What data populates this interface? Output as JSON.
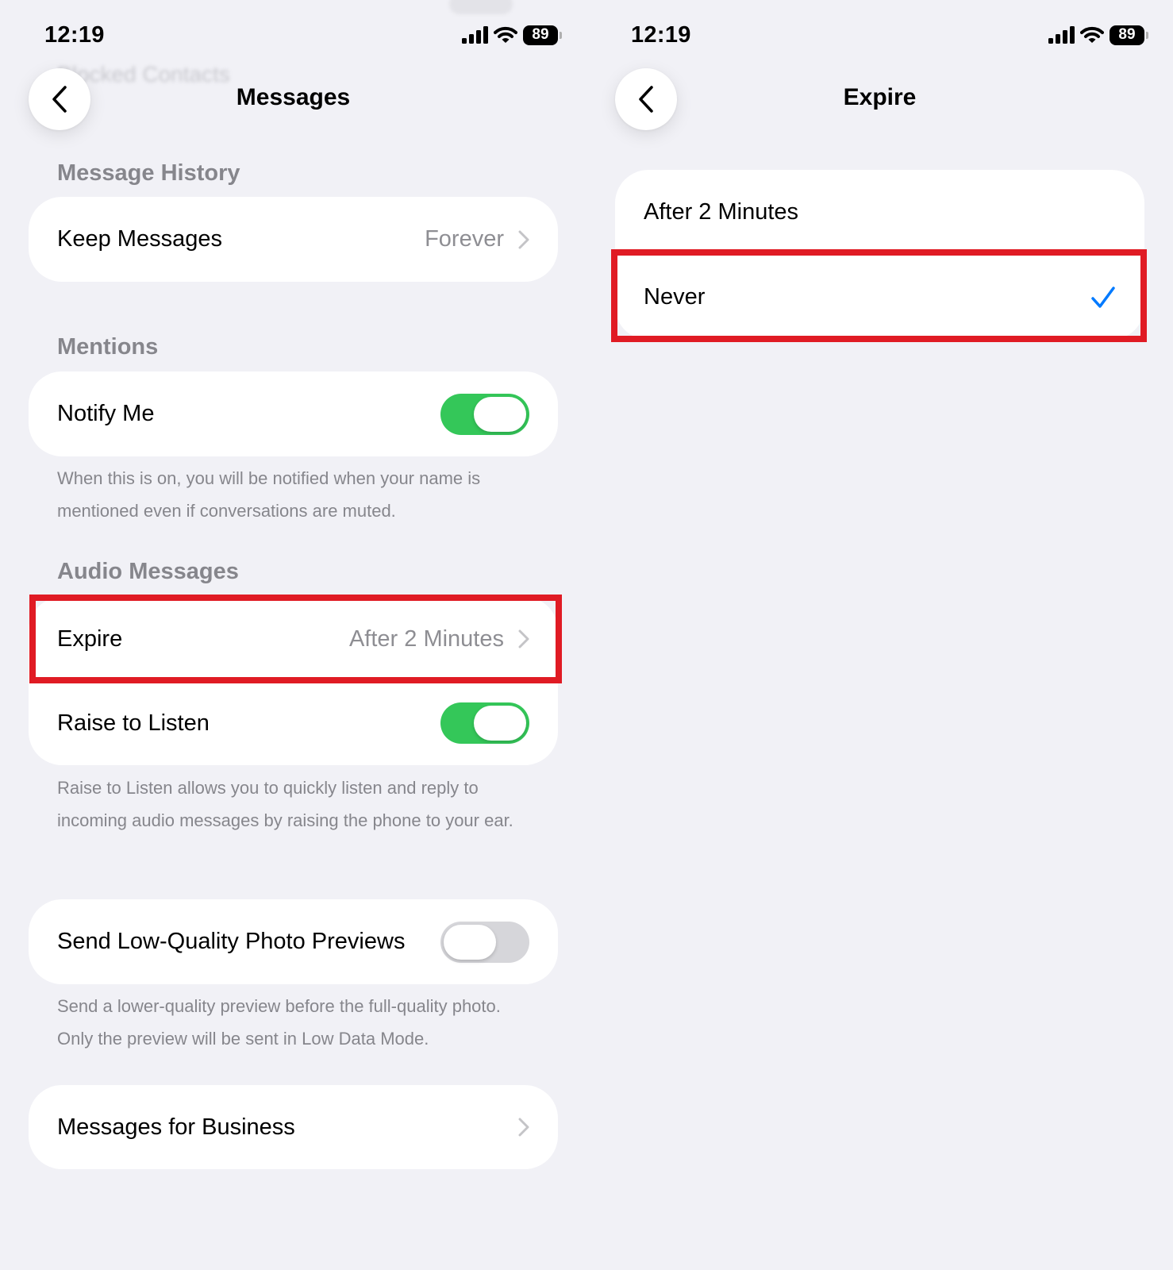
{
  "status_bar": {
    "time": "12:19",
    "battery": "89"
  },
  "colors": {
    "background": "#f1f1f6",
    "card": "#ffffff",
    "toggle_on": "#34c759",
    "toggle_off": "#d6d6da",
    "highlight": "#e01b24",
    "accent": "#007aff"
  },
  "messages_screen": {
    "ghost_text": "Blocked Contacts",
    "title": "Messages",
    "back_icon": "chevron-left-icon",
    "message_history": {
      "header": "Message History",
      "keep_messages": {
        "label": "Keep Messages",
        "value": "Forever"
      }
    },
    "mentions": {
      "header": "Mentions",
      "notify_me": {
        "label": "Notify Me",
        "enabled": true
      },
      "footnote": "When this is on, you will be notified when your name is mentioned even if conversations are muted."
    },
    "audio_messages": {
      "header": "Audio Messages",
      "expire": {
        "label": "Expire",
        "value": "After 2 Minutes"
      },
      "raise_to_listen": {
        "label": "Raise to Listen",
        "enabled": true
      },
      "footnote": "Raise to Listen allows you to quickly listen and reply to incoming audio messages by raising the phone to your ear."
    },
    "photo_previews": {
      "label": "Send Low-Quality Photo Previews",
      "enabled": false,
      "footnote": "Send a lower-quality preview before the full-quality photo. Only the preview will be sent in Low Data Mode."
    },
    "business": {
      "label": "Messages for Business"
    }
  },
  "expire_screen": {
    "title": "Expire",
    "back_icon": "chevron-left-icon",
    "options": [
      {
        "label": "After 2 Minutes",
        "selected": false
      },
      {
        "label": "Never",
        "selected": true
      }
    ]
  }
}
